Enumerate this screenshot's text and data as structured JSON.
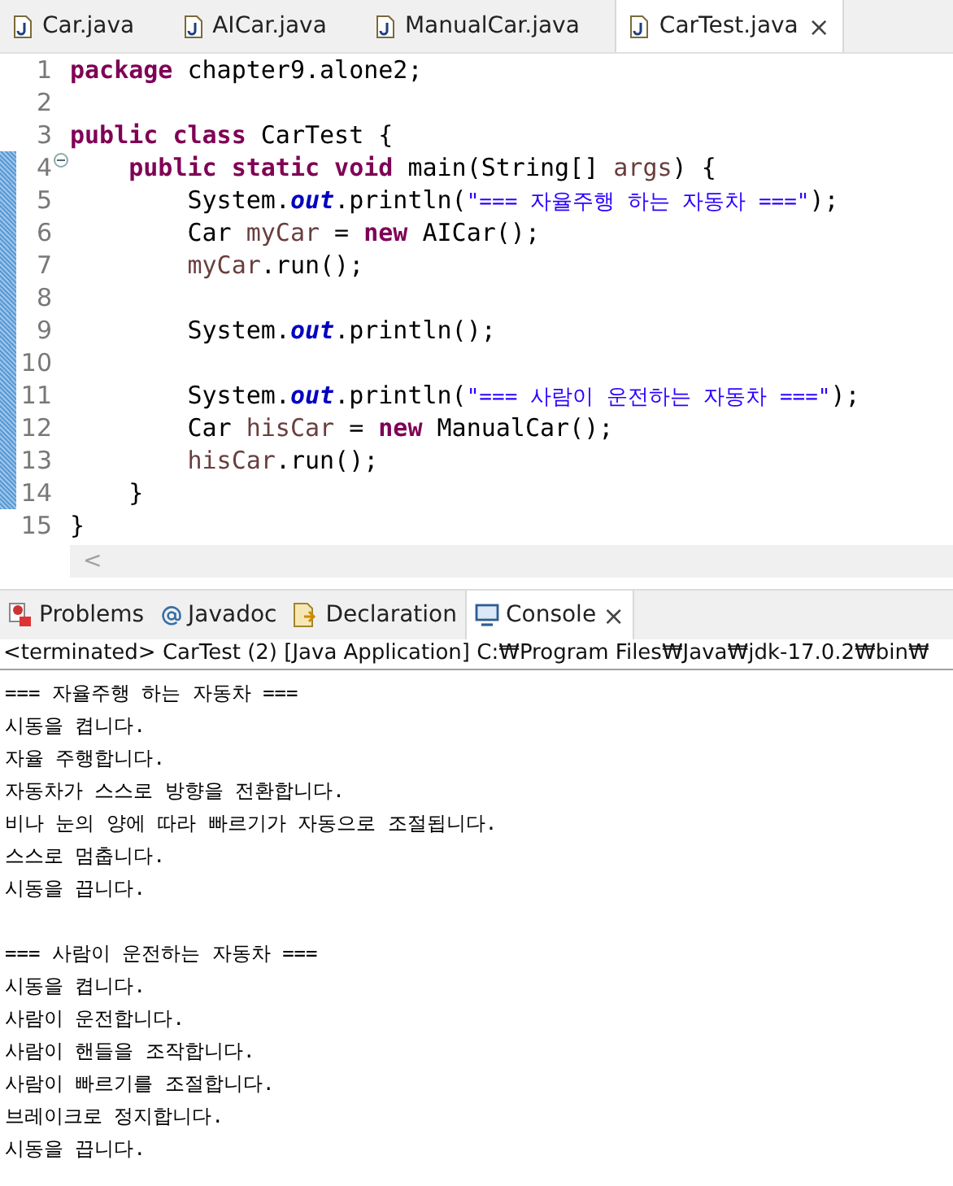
{
  "editor_tabs": [
    {
      "label": "Car.java",
      "selected": false
    },
    {
      "label": "AICar.java",
      "selected": false
    },
    {
      "label": "ManualCar.java",
      "selected": false
    },
    {
      "label": "CarTest.java",
      "selected": true,
      "close": "×"
    }
  ],
  "code_lines": [
    {
      "number": "1",
      "changed": false,
      "tokens": [
        {
          "kind": "keyword",
          "t": "package"
        },
        {
          "kind": "plain",
          "t": " chapter9.alone2;"
        }
      ]
    },
    {
      "number": "2",
      "changed": false
    },
    {
      "number": "3",
      "changed": false,
      "tokens": [
        {
          "kind": "keyword",
          "t": "public class"
        },
        {
          "kind": "plain",
          "t": " CarTest {"
        }
      ]
    },
    {
      "number": "4",
      "changed": true,
      "folding": true,
      "tokens": [
        {
          "kind": "keyword",
          "t": "    public static void"
        },
        {
          "kind": "plain",
          "t": " main(String[] "
        },
        {
          "kind": "local",
          "t": "args"
        },
        {
          "kind": "plain",
          "t": ") {"
        }
      ]
    },
    {
      "number": "5",
      "changed": true,
      "tokens": [
        {
          "kind": "plain",
          "t": "        System."
        },
        {
          "kind": "field",
          "t": "out"
        },
        {
          "kind": "plain",
          "t": ".println("
        },
        {
          "kind": "string",
          "t": "\"=== 자율주행 하는 자동차 ===\""
        },
        {
          "kind": "plain",
          "t": ");"
        }
      ]
    },
    {
      "number": "6",
      "changed": true,
      "tokens": [
        {
          "kind": "plain",
          "t": "        Car "
        },
        {
          "kind": "local",
          "t": "myCar"
        },
        {
          "kind": "plain",
          "t": " = "
        },
        {
          "kind": "keyword",
          "t": "new"
        },
        {
          "kind": "plain",
          "t": " AICar();"
        }
      ]
    },
    {
      "number": "7",
      "changed": true,
      "tokens": [
        {
          "kind": "local",
          "t": "        myCar"
        },
        {
          "kind": "plain",
          "t": ".run();"
        }
      ]
    },
    {
      "number": "8",
      "changed": true
    },
    {
      "number": "9",
      "changed": true,
      "tokens": [
        {
          "kind": "plain",
          "t": "        System."
        },
        {
          "kind": "field",
          "t": "out"
        },
        {
          "kind": "plain",
          "t": ".println();"
        }
      ]
    },
    {
      "number": "10",
      "changed": true
    },
    {
      "number": "11",
      "changed": true,
      "tokens": [
        {
          "kind": "plain",
          "t": "        System."
        },
        {
          "kind": "field",
          "t": "out"
        },
        {
          "kind": "plain",
          "t": ".println("
        },
        {
          "kind": "string",
          "t": "\"=== 사람이 운전하는 자동차 ===\""
        },
        {
          "kind": "plain",
          "t": ");"
        }
      ]
    },
    {
      "number": "12",
      "changed": true,
      "tokens": [
        {
          "kind": "plain",
          "t": "        Car "
        },
        {
          "kind": "local",
          "t": "hisCar"
        },
        {
          "kind": "plain",
          "t": " = "
        },
        {
          "kind": "keyword",
          "t": "new"
        },
        {
          "kind": "plain",
          "t": " ManualCar();"
        }
      ]
    },
    {
      "number": "13",
      "changed": true,
      "tokens": [
        {
          "kind": "local",
          "t": "        hisCar"
        },
        {
          "kind": "plain",
          "t": ".run();"
        }
      ]
    },
    {
      "number": "14",
      "changed": true,
      "tokens": [
        {
          "kind": "plain",
          "t": "    }"
        }
      ]
    },
    {
      "number": "15",
      "changed": false,
      "tokens": [
        {
          "kind": "plain",
          "t": "}"
        }
      ]
    }
  ],
  "scroll_left": "<",
  "view_tabs": [
    {
      "label": "Problems",
      "selected": false
    },
    {
      "label": "Javadoc",
      "selected": false
    },
    {
      "label": "Declaration",
      "selected": false
    },
    {
      "label": "Console",
      "selected": true,
      "close": "×"
    }
  ],
  "console_header": "<terminated> CarTest (2) [Java Application] C:₩Program Files₩Java₩jdk-17.0.2₩bin₩",
  "console_blocks": [
    [
      "=== 자율주행 하는 자동차 ===",
      "시동을 켭니다.",
      "자율 주행합니다.",
      "자동차가 스스로 방향을 전환합니다.",
      "비나 눈의 양에 따라 빠르기가 자동으로 조절됩니다.",
      "스스로 멈춥니다.",
      "시동을 끕니다."
    ],
    [
      "=== 사람이 운전하는 자동차 ===",
      "시동을 켭니다.",
      "사람이 운전합니다.",
      "사람이 핸들을 조작합니다.",
      "사람이 빠르기를 조절합니다.",
      "브레이크로 정지합니다.",
      "시동을 끕니다."
    ]
  ]
}
